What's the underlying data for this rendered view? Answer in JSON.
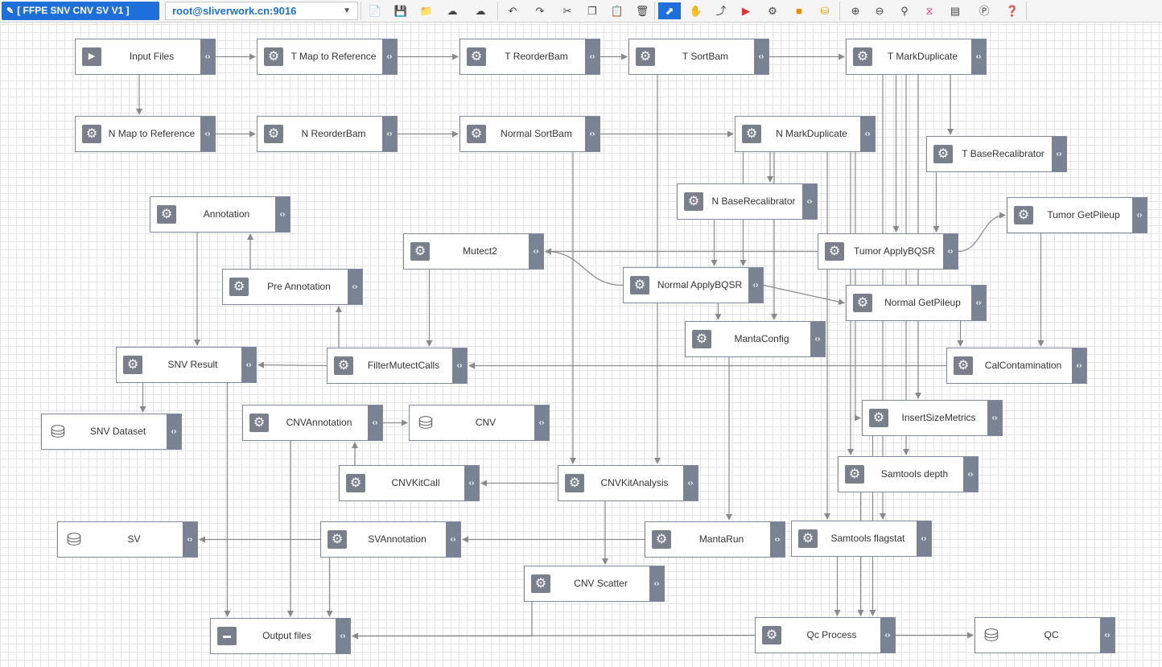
{
  "toolbar": {
    "title": "[ FFPE SNV CNV SV V1 ]",
    "server": "root@sliverwork.cn:9016",
    "buttons": [
      "new-file",
      "save",
      "open-folder",
      "upload",
      "download",
      "undo",
      "redo",
      "cut",
      "copy",
      "paste",
      "delete",
      "pointer",
      "hand",
      "connect",
      "run",
      "settings",
      "storage",
      "database",
      "zoom-in",
      "zoom-out",
      "zoom-reset",
      "dna",
      "layout",
      "credits",
      "help"
    ]
  },
  "nodes": [
    {
      "id": "input",
      "label": "Input Files",
      "icon": "play"
    },
    {
      "id": "tmap",
      "label": "T Map to Reference",
      "icon": "gear"
    },
    {
      "id": "treorder",
      "label": "T ReorderBam",
      "icon": "gear"
    },
    {
      "id": "tsort",
      "label": "T SortBam",
      "icon": "gear"
    },
    {
      "id": "tmarkdup",
      "label": "T MarkDuplicate",
      "icon": "gear"
    },
    {
      "id": "nmap",
      "label": "N Map to Reference",
      "icon": "gear"
    },
    {
      "id": "nreorder",
      "label": "N ReorderBam",
      "icon": "gear"
    },
    {
      "id": "nsort",
      "label": "Normal SortBam",
      "icon": "gear"
    },
    {
      "id": "nmarkdup",
      "label": "N MarkDuplicate",
      "icon": "gear"
    },
    {
      "id": "tbaserecal",
      "label": "T BaseRecalibrator",
      "icon": "gear"
    },
    {
      "id": "nbaserecal",
      "label": "N BaseRecalibrator",
      "icon": "gear"
    },
    {
      "id": "annotation",
      "label": "Annotation",
      "icon": "gear"
    },
    {
      "id": "tumorpileup",
      "label": "Tumor GetPileup",
      "icon": "gear"
    },
    {
      "id": "mutect2",
      "label": "Mutect2",
      "icon": "gear"
    },
    {
      "id": "tapplybqsr",
      "label": "Tumor ApplyBQSR",
      "icon": "gear"
    },
    {
      "id": "preannotation",
      "label": "Pre Annotation",
      "icon": "gear"
    },
    {
      "id": "napplybqsr",
      "label": "Normal ApplyBQSR",
      "icon": "gear"
    },
    {
      "id": "normalpileup",
      "label": "Normal GetPileup",
      "icon": "gear"
    },
    {
      "id": "mantaconfig",
      "label": "MantaConfig",
      "icon": "gear"
    },
    {
      "id": "snvresult",
      "label": "SNV Result",
      "icon": "gear"
    },
    {
      "id": "filtermutect",
      "label": "FilterMutectCalls",
      "icon": "gear"
    },
    {
      "id": "calcontam",
      "label": "CalContamination",
      "icon": "gear"
    },
    {
      "id": "snvdataset",
      "label": "SNV Dataset",
      "icon": "db"
    },
    {
      "id": "cnvannotation",
      "label": "CNVAnnotation",
      "icon": "gear"
    },
    {
      "id": "cnv",
      "label": "CNV",
      "icon": "db"
    },
    {
      "id": "insertsize",
      "label": "InsertSizeMetrics",
      "icon": "gear"
    },
    {
      "id": "samtoolsdepth",
      "label": "Samtools depth",
      "icon": "gear"
    },
    {
      "id": "cnvkitcall",
      "label": "CNVKitCall",
      "icon": "gear"
    },
    {
      "id": "cnvkitanalysis",
      "label": "CNVKitAnalysis",
      "icon": "gear"
    },
    {
      "id": "sv",
      "label": "SV",
      "icon": "db"
    },
    {
      "id": "svannotation",
      "label": "SVAnnotation",
      "icon": "gear"
    },
    {
      "id": "mantarun",
      "label": "MantaRun",
      "icon": "gear"
    },
    {
      "id": "samtoolsflagstat",
      "label": "Samtools flagstat",
      "icon": "gear"
    },
    {
      "id": "cnvscatter",
      "label": "CNV Scatter",
      "icon": "gear"
    },
    {
      "id": "outputfiles",
      "label": "Output files",
      "icon": "output"
    },
    {
      "id": "qcprocess",
      "label": "Qc Process",
      "icon": "gear"
    },
    {
      "id": "qc",
      "label": "QC",
      "icon": "db"
    }
  ],
  "edges": [
    [
      "input",
      "tmap"
    ],
    [
      "tmap",
      "treorder"
    ],
    [
      "treorder",
      "tsort"
    ],
    [
      "tsort",
      "tmarkdup"
    ],
    [
      "input",
      "nmap"
    ],
    [
      "nmap",
      "nreorder"
    ],
    [
      "nreorder",
      "nsort"
    ],
    [
      "nsort",
      "nmarkdup"
    ],
    [
      "tmarkdup",
      "tbaserecal"
    ],
    [
      "nmarkdup",
      "nbaserecal"
    ],
    [
      "tmarkdup",
      "tapplybqsr"
    ],
    [
      "tbaserecal",
      "tapplybqsr"
    ],
    [
      "nmarkdup",
      "napplybqsr"
    ],
    [
      "nbaserecal",
      "napplybqsr"
    ],
    [
      "tapplybqsr",
      "tumorpileup"
    ],
    [
      "tapplybqsr",
      "mutect2"
    ],
    [
      "napplybqsr",
      "mutect2"
    ],
    [
      "napplybqsr",
      "normalpileup"
    ],
    [
      "napplybqsr",
      "mantaconfig"
    ],
    [
      "nmarkdup",
      "mantaconfig"
    ],
    [
      "normalpileup",
      "calcontam"
    ],
    [
      "tumorpileup",
      "calcontam"
    ],
    [
      "calcontam",
      "filtermutect"
    ],
    [
      "mutect2",
      "filtermutect"
    ],
    [
      "filtermutect",
      "preannotation"
    ],
    [
      "preannotation",
      "annotation"
    ],
    [
      "annotation",
      "snvresult"
    ],
    [
      "filtermutect",
      "snvresult"
    ],
    [
      "snvresult",
      "snvdataset"
    ],
    [
      "tmarkdup",
      "insertsize"
    ],
    [
      "tmarkdup",
      "samtoolsdepth"
    ],
    [
      "tmarkdup",
      "samtoolsflagstat"
    ],
    [
      "nmarkdup",
      "insertsize"
    ],
    [
      "nmarkdup",
      "samtoolsdepth"
    ],
    [
      "nmarkdup",
      "samtoolsflagstat"
    ],
    [
      "tsort",
      "cnvkitanalysis"
    ],
    [
      "nsort",
      "cnvkitanalysis"
    ],
    [
      "cnvkitanalysis",
      "cnvkitcall"
    ],
    [
      "cnvkitcall",
      "cnvannotation"
    ],
    [
      "cnvannotation",
      "cnv"
    ],
    [
      "cnvkitanalysis",
      "cnvscatter"
    ],
    [
      "mantaconfig",
      "mantarun"
    ],
    [
      "mantarun",
      "svannotation"
    ],
    [
      "svannotation",
      "sv"
    ],
    [
      "samtoolsflagstat",
      "qcprocess"
    ],
    [
      "samtoolsdepth",
      "qcprocess"
    ],
    [
      "insertsize",
      "qcprocess"
    ],
    [
      "qcprocess",
      "qc"
    ],
    [
      "qcprocess",
      "outputfiles"
    ],
    [
      "snvresult",
      "outputfiles"
    ],
    [
      "cnvannotation",
      "outputfiles"
    ],
    [
      "svannotation",
      "outputfiles"
    ],
    [
      "cnvscatter",
      "outputfiles"
    ]
  ]
}
